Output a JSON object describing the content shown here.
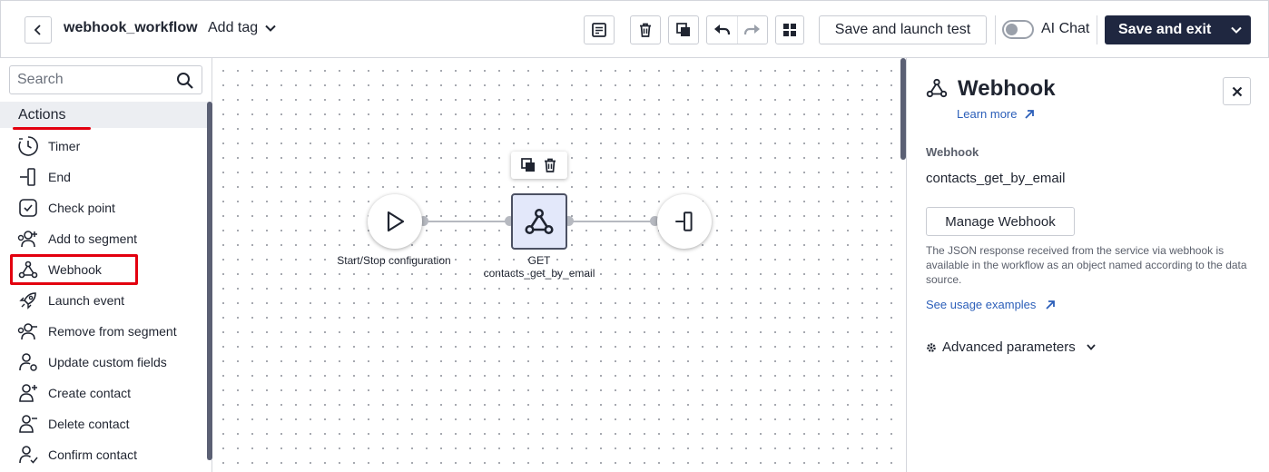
{
  "header": {
    "workflow_name": "webhook_workflow",
    "add_tag_label": "Add tag",
    "save_launch_label": "Save and launch test",
    "ai_chat_label": "AI Chat",
    "ai_chat_enabled": false,
    "save_exit_label": "Save and exit"
  },
  "sidebar": {
    "search_placeholder": "Search",
    "section_title": "Actions",
    "items": [
      {
        "label": "Timer",
        "icon": "timer-icon"
      },
      {
        "label": "End",
        "icon": "end-icon"
      },
      {
        "label": "Check point",
        "icon": "check-point-icon"
      },
      {
        "label": "Add to segment",
        "icon": "add-segment-icon"
      },
      {
        "label": "Webhook",
        "icon": "webhook-icon"
      },
      {
        "label": "Launch event",
        "icon": "rocket-icon"
      },
      {
        "label": "Remove from segment",
        "icon": "remove-segment-icon"
      },
      {
        "label": "Update custom fields",
        "icon": "update-fields-icon"
      },
      {
        "label": "Create contact",
        "icon": "create-contact-icon"
      },
      {
        "label": "Delete contact",
        "icon": "delete-contact-icon"
      },
      {
        "label": "Confirm contact",
        "icon": "confirm-contact-icon"
      }
    ]
  },
  "canvas": {
    "start_label": "Start/Stop configuration",
    "webhook_method": "GET",
    "webhook_name": "contacts_get_by_email"
  },
  "panel": {
    "title": "Webhook",
    "learn_more": "Learn more",
    "field_label": "Webhook",
    "field_value": "contacts_get_by_email",
    "manage_label": "Manage Webhook",
    "description": "The JSON response received from the service via webhook is available in the workflow as an object named according to the data source.",
    "usage_link": "See usage examples",
    "advanced_label": "Advanced parameters"
  },
  "colors": {
    "accent_dark": "#1f2740",
    "link": "#2c5fb9",
    "highlight_red": "#e3000f",
    "node_fill": "#e3e8fa"
  }
}
